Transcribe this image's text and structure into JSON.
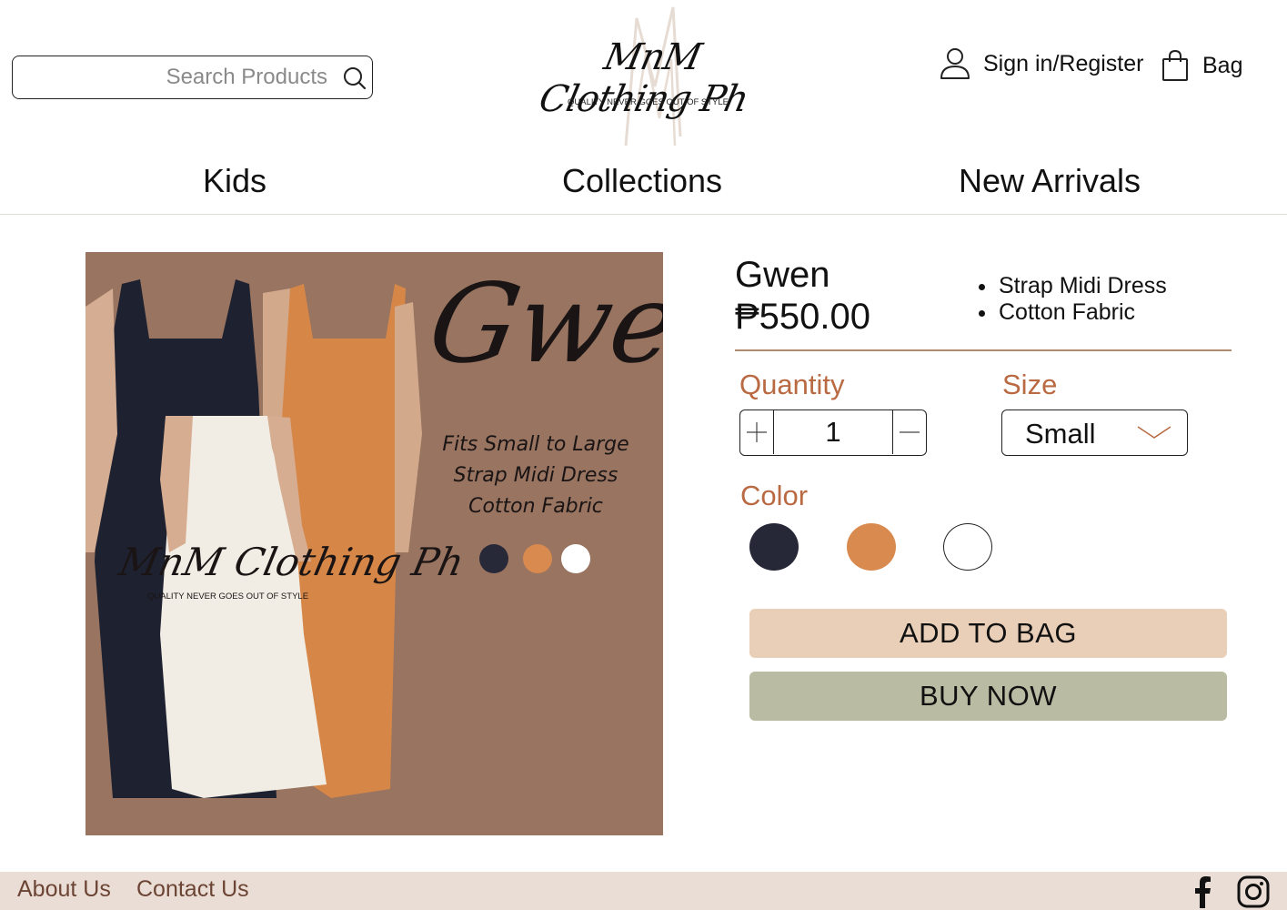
{
  "header": {
    "search": {
      "placeholder": "Search Products",
      "value": ""
    },
    "logo": {
      "name": "MnM Clothing Ph",
      "tagline": "QUALITY NEVER GOES OUT OF STYLE"
    },
    "signin_label": "Sign in/Register",
    "bag_label": "Bag"
  },
  "nav": {
    "items": [
      {
        "label": "Kids"
      },
      {
        "label": "Collections"
      },
      {
        "label": "New Arrivals"
      }
    ]
  },
  "product": {
    "name": "Gwen",
    "price": "₱550.00",
    "features": [
      "Strap Midi Dress",
      "Cotton Fabric"
    ],
    "image": {
      "title": "Gwen",
      "lines": [
        "Fits Small to Large",
        "Strap Midi Dress",
        "Cotton Fabric"
      ],
      "dot_colors": [
        "#272838",
        "#d98a4e",
        "#ffffff"
      ],
      "watermark": "MnM Clothing Ph",
      "watermark_tagline": "QUALITY NEVER GOES OUT OF STYLE"
    }
  },
  "options": {
    "quantity_label": "Quantity",
    "quantity_value": "1",
    "size_label": "Size",
    "size_value": "Small",
    "color_label": "Color",
    "colors": [
      {
        "name": "navy",
        "hex": "#262838"
      },
      {
        "name": "orange",
        "hex": "#d98a4e"
      },
      {
        "name": "white",
        "hex": "#ffffff"
      }
    ]
  },
  "actions": {
    "add_to_bag": "ADD TO BAG",
    "buy_now": "BUY NOW"
  },
  "footer": {
    "links": [
      "About Us",
      "Contact Us"
    ],
    "social": [
      "facebook-icon",
      "instagram-icon"
    ]
  },
  "colors": {
    "accent": "#b96a42",
    "add_to_bag_bg": "#eacfb8",
    "buy_now_bg": "#b9bba2",
    "footer_bg": "#eaddd5",
    "image_bg": "#987461"
  }
}
